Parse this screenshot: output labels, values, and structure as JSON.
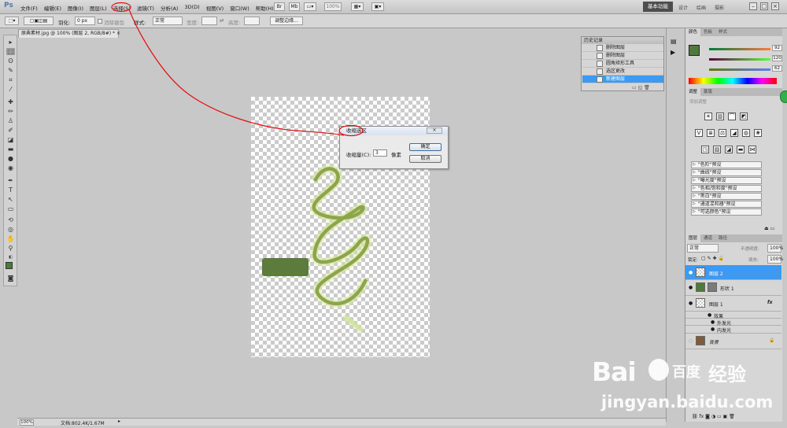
{
  "menubar": {
    "logo": "Ps",
    "items": [
      "文件(F)",
      "编辑(E)",
      "图像(I)",
      "图层(L)",
      "选择(S)",
      "滤镜(T)",
      "分析(A)",
      "3D(D)",
      "视图(V)",
      "窗口(W)",
      "帮助(H)"
    ],
    "zoom": "100%",
    "workspace_button": "基本功能",
    "workspace_links": [
      "设计",
      "绘画",
      "摄影"
    ],
    "window_buttons": [
      "–",
      "□",
      "×"
    ]
  },
  "options": {
    "feather_label": "羽化:",
    "feather_value": "0 px",
    "antialias_label": "消除锯齿",
    "style_label": "样式:",
    "style_value": "正常",
    "width_label": "宽度:",
    "height_label": "高度:",
    "refine_button": "调整边缘..."
  },
  "document": {
    "tab_title": "原典素材.jpg @ 100% (图层 2, RGB/8#) *",
    "close": "×"
  },
  "dialog": {
    "title": "收缩选区",
    "close": "×",
    "label": "收缩量(C):",
    "value": "3",
    "unit": "像素",
    "ok": "确定",
    "cancel": "取消"
  },
  "history": {
    "title": "历史记录",
    "items": [
      {
        "label": "删除图层",
        "active": false
      },
      {
        "label": "删除图层",
        "active": false
      },
      {
        "label": "圆角矩形工具",
        "active": false
      },
      {
        "label": "选区更改",
        "active": false
      },
      {
        "label": "新建图层",
        "active": true
      }
    ]
  },
  "color_panel": {
    "tabs": [
      "颜色",
      "色板",
      "样式"
    ],
    "values": [
      "92",
      "120",
      "62"
    ],
    "fg": "#4f7a39"
  },
  "adjustments": {
    "tabs": [
      "调整",
      "蒙版"
    ],
    "hint": "添加调整",
    "presets": [
      "\"色阶\"预设",
      "\"曲线\"预设",
      "\"曝光度\"预设",
      "\"色相/饱和度\"预设",
      "\"黑白\"预设",
      "\"通道混和器\"预设",
      "\"可选颜色\"预设"
    ]
  },
  "layers": {
    "tabs": [
      "图层",
      "通道",
      "路径"
    ],
    "blend_mode": "正常",
    "opacity_label": "不透明度:",
    "opacity": "100%",
    "lock_label": "锁定:",
    "fill_label": "填充:",
    "fill": "100%",
    "rows": [
      {
        "name": "图层 2",
        "active": true
      },
      {
        "name": "形状 1",
        "active": false
      },
      {
        "name": "图层 1",
        "active": false,
        "fx": "fx"
      },
      {
        "name": "效果",
        "active": false
      },
      {
        "name": "外发光",
        "active": false
      },
      {
        "name": "内发光",
        "active": false
      },
      {
        "name": "背景",
        "active": false
      }
    ]
  },
  "status": {
    "zoom": "100%",
    "doc": "文档:802.4K/1.67M"
  },
  "watermark": {
    "logo": "Bai",
    "logo2": "百度",
    "jingyan": "经验",
    "url": "jingyan.baidu.com"
  },
  "colors": {
    "accent": "#3d99f2",
    "shape_green": "#5b7c3c",
    "annotation": "#e01010"
  }
}
